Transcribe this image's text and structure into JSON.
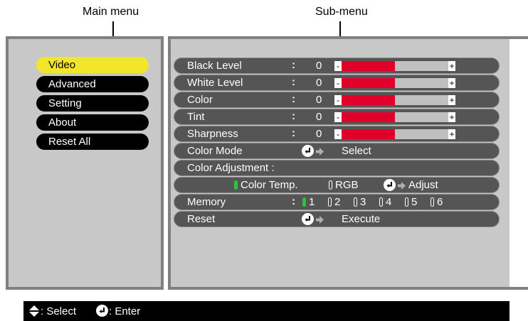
{
  "callouts": {
    "main": "Main menu",
    "sub": "Sub-menu"
  },
  "main_menu": {
    "items": [
      {
        "label": "Video",
        "active": true
      },
      {
        "label": "Advanced",
        "active": false
      },
      {
        "label": "Setting",
        "active": false
      },
      {
        "label": "About",
        "active": false
      },
      {
        "label": "Reset All",
        "active": false
      }
    ]
  },
  "sub_menu": {
    "sliders": [
      {
        "label": "Black Level",
        "value": "0",
        "fill_fraction": 0.5
      },
      {
        "label": "White Level",
        "value": "0",
        "fill_fraction": 0.5
      },
      {
        "label": "Color",
        "value": "0",
        "fill_fraction": 0.5
      },
      {
        "label": "Tint",
        "value": "0",
        "fill_fraction": 0.5
      },
      {
        "label": "Sharpness",
        "value": "0",
        "fill_fraction": 0.5
      }
    ],
    "colon": ":",
    "bar_minus": "-",
    "bar_plus": "+",
    "color_mode": {
      "label": "Color Mode",
      "action": "Select"
    },
    "color_adjustment": {
      "label": "Color Adjustment :"
    },
    "adjust_row": {
      "option1": "Color Temp.",
      "option2": "RGB",
      "action": "Adjust",
      "selected": "Color Temp."
    },
    "memory": {
      "label": "Memory",
      "slots": [
        "1",
        "2",
        "3",
        "4",
        "5",
        "6"
      ],
      "selected": "1"
    },
    "reset": {
      "label": "Reset",
      "action": "Execute"
    }
  },
  "footer": {
    "select": ": Select",
    "enter": ": Enter"
  },
  "colors": {
    "active_item": "#f2e62c",
    "bar_fill": "#e0002a",
    "radio_on": "#2cc23c",
    "panel": "#c8c8c8",
    "border": "#808080"
  }
}
